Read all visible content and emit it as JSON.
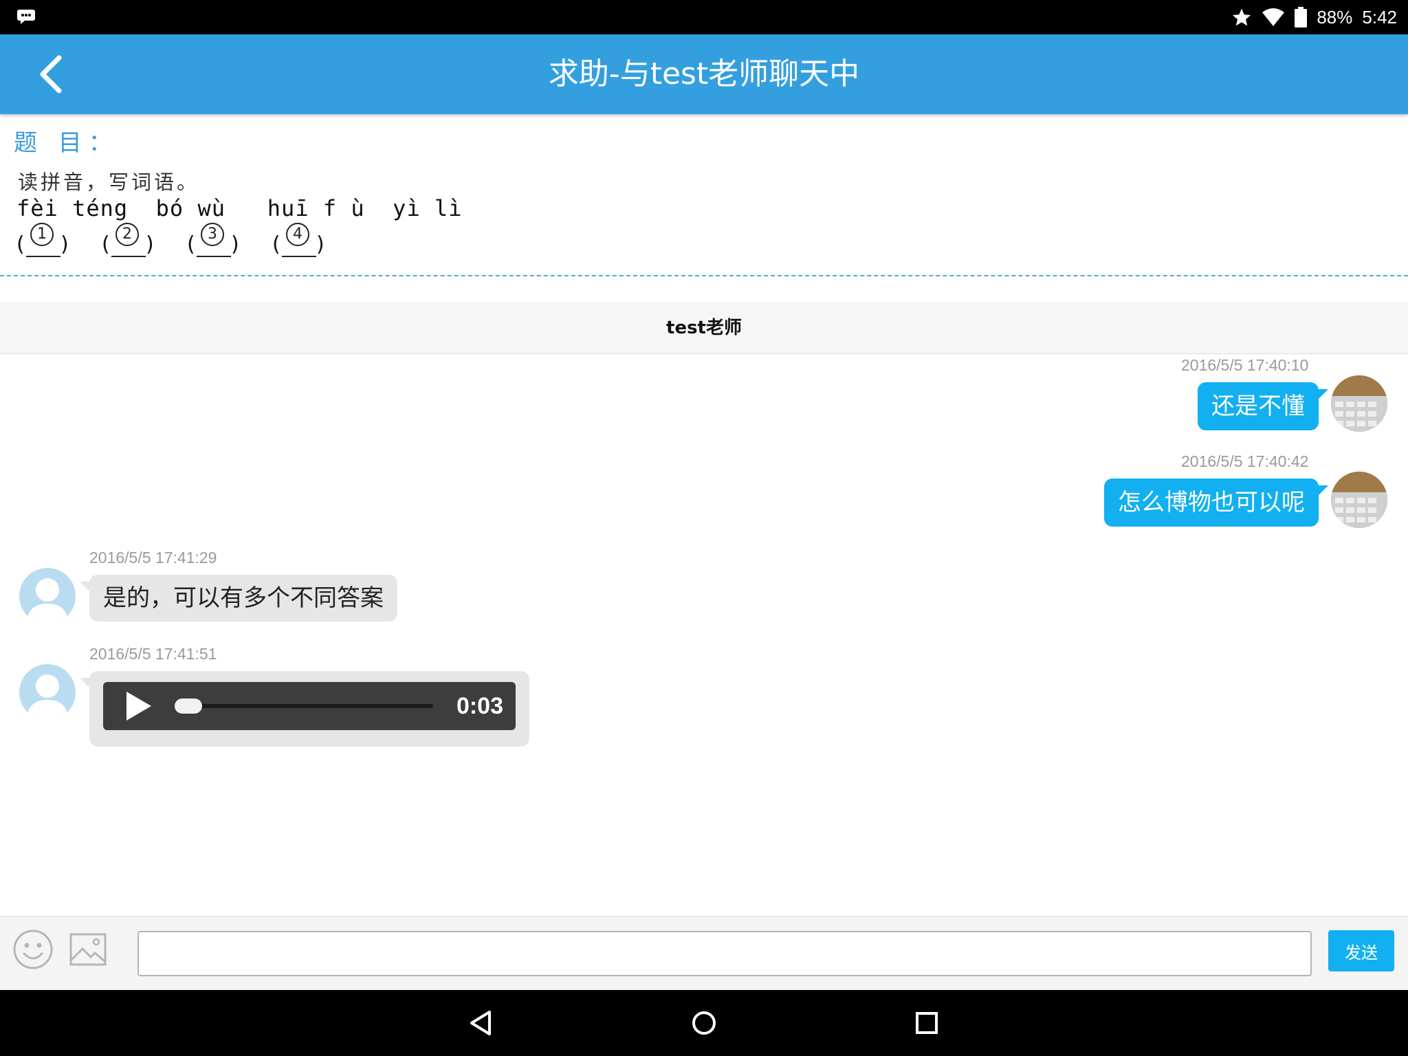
{
  "status_bar": {
    "battery": "88%",
    "time": "5:42"
  },
  "header": {
    "title": "求助-与test老师聊天中"
  },
  "question": {
    "label": "题 目：",
    "instruction": "读拼音，写词语。",
    "pinyin": "fèi téng  bó wù   huī f ù  yì lì",
    "blanks": [
      "1",
      "2",
      "3",
      "4"
    ]
  },
  "chat": {
    "partner_name": "test老师",
    "messages": [
      {
        "direction": "outgoing",
        "timestamp": "2016/5/5 17:40:10",
        "text": "还是不懂"
      },
      {
        "direction": "outgoing",
        "timestamp": "2016/5/5 17:40:42",
        "text": "怎么博物也可以呢"
      },
      {
        "direction": "incoming",
        "timestamp": "2016/5/5 17:41:29",
        "text": "是的，可以有多个不同答案"
      },
      {
        "direction": "incoming",
        "timestamp": "2016/5/5 17:41:51",
        "audio_duration": "0:03",
        "audio_progress": 0.0
      }
    ]
  },
  "input_bar": {
    "message_value": "",
    "send_label": "发送"
  },
  "colors": {
    "title_bar": "#349fde",
    "outgoing_bubble": "#12b0f0",
    "incoming_bubble": "#e6e6e6",
    "send_button": "#12b0f0"
  },
  "icons": {
    "status_left": "chat-notification-icon",
    "status_right": [
      "star-icon",
      "wifi-icon",
      "battery-icon"
    ],
    "back": "chevron-left-icon",
    "emoji": "smiley-icon",
    "image": "image-icon",
    "audio_play": "play-icon",
    "nav": [
      "back-triangle-icon",
      "home-circle-icon",
      "recents-square-icon"
    ]
  }
}
